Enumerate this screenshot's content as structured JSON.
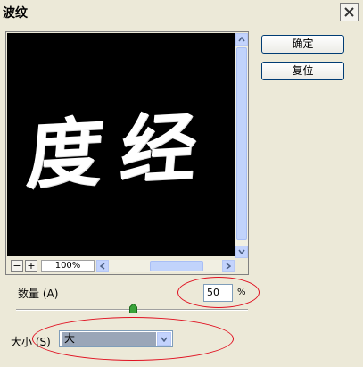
{
  "window": {
    "title": "波纹"
  },
  "preview": {
    "text": "度经",
    "zoom": "100%"
  },
  "buttons": {
    "ok": "确定",
    "reset": "复位"
  },
  "amount": {
    "label": "数量 (A)",
    "value": "50",
    "unit": "%",
    "level": 0.5
  },
  "size": {
    "label": "大小 (S)",
    "selected": "大"
  },
  "colors": {
    "annotation": "#e01020",
    "preview_background": "#000000"
  }
}
